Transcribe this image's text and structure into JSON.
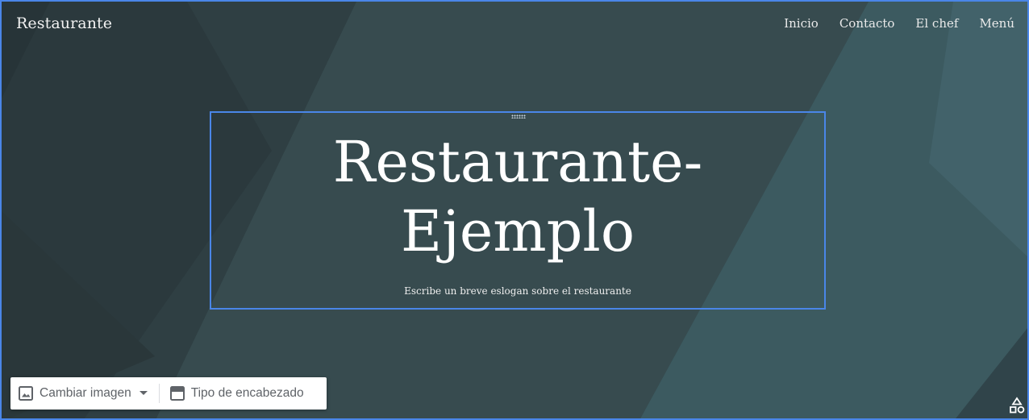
{
  "site": {
    "title": "Restaurante",
    "nav": [
      "Inicio",
      "Contacto",
      "El chef",
      "Menú"
    ]
  },
  "header": {
    "heading_line1": "Restaurante-",
    "heading_line2": "Ejemplo",
    "slogan": "Escribe un breve eslogan sobre el restaurante"
  },
  "toolbar": {
    "change_image_label": "Cambiar imagen",
    "header_type_label": "Tipo de encabezado"
  },
  "icons": {
    "image": "image-icon",
    "dropdown": "dropdown-arrow-icon",
    "header_type": "header-layout-icon",
    "shapes": "shapes-icon"
  },
  "colors": {
    "selection_border": "#4a86e8",
    "background": "#33464a",
    "text": "#ffffff"
  }
}
